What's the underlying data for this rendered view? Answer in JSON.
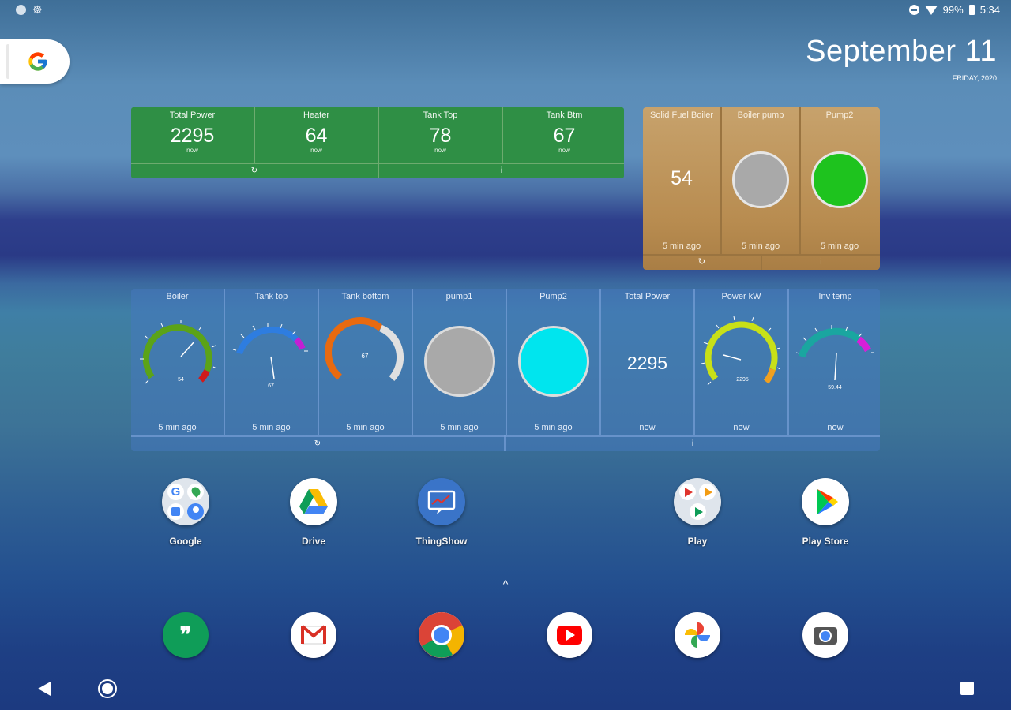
{
  "status_bar": {
    "battery": "99%",
    "time": "5:34",
    "icons": [
      "notification-dot-icon",
      "bug-icon",
      "do-not-disturb-icon",
      "wifi-icon",
      "battery-icon"
    ]
  },
  "search": {
    "icon": "google-g-icon"
  },
  "date": {
    "main": "September 11",
    "sub": "FRIDAY, 2020"
  },
  "green_widget": {
    "cells": [
      {
        "label": "Total Power",
        "value": "2295",
        "time": "now"
      },
      {
        "label": "Heater",
        "value": "64",
        "time": "now"
      },
      {
        "label": "Tank Top",
        "value": "78",
        "time": "now"
      },
      {
        "label": "Tank Btm",
        "value": "67",
        "time": "now"
      }
    ],
    "refresh_glyph": "↻",
    "info_glyph": "i",
    "color": "#2f8f45"
  },
  "tan_widget": {
    "cells": [
      {
        "label": "Solid Fuel Boiler",
        "value": "54",
        "time": "5 min ago"
      },
      {
        "label": "Boiler pump",
        "time": "5 min ago",
        "lamp_color": "#a9a9a9"
      },
      {
        "label": "Pump2",
        "time": "5 min ago",
        "lamp_color": "#1ec31e"
      }
    ],
    "refresh_glyph": "↻",
    "info_glyph": "i"
  },
  "blue_widget": {
    "cells": [
      {
        "label": "Boiler",
        "time": "5 min ago",
        "gauge_value": "54"
      },
      {
        "label": "Tank top",
        "time": "5 min ago",
        "gauge_value": "67"
      },
      {
        "label": "Tank bottom",
        "time": "5 min ago",
        "gauge_value": "67"
      },
      {
        "label": "pump1",
        "time": "5 min ago",
        "lamp_color": "#a9a9a9"
      },
      {
        "label": "Pump2",
        "time": "5 min ago",
        "lamp_color": "#00e5ee"
      },
      {
        "label": "Total Power",
        "time": "now",
        "value": "2295"
      },
      {
        "label": "Power kW",
        "time": "now",
        "gauge_value": "2295"
      },
      {
        "label": "Inv temp",
        "time": "now",
        "gauge_value": "59.44"
      }
    ],
    "refresh_glyph": "↻",
    "info_glyph": "i"
  },
  "apps": [
    {
      "name": "Google",
      "icon": "google-folder-icon"
    },
    {
      "name": "Drive",
      "icon": "google-drive-icon"
    },
    {
      "name": "ThingShow",
      "icon": "thingshow-icon"
    },
    {
      "name": "Play",
      "icon": "play-folder-icon"
    },
    {
      "name": "Play Store",
      "icon": "play-store-icon"
    }
  ],
  "dock": [
    {
      "name": "Hangouts",
      "icon": "hangouts-icon"
    },
    {
      "name": "Gmail",
      "icon": "gmail-icon"
    },
    {
      "name": "Chrome",
      "icon": "chrome-icon"
    },
    {
      "name": "YouTube",
      "icon": "youtube-icon"
    },
    {
      "name": "Photos",
      "icon": "photos-icon"
    },
    {
      "name": "Camera",
      "icon": "camera-icon"
    }
  ],
  "app_drawer": {
    "glyph": "^"
  },
  "nav": {
    "icons": [
      "back-icon",
      "home-icon",
      "recents-icon"
    ]
  }
}
